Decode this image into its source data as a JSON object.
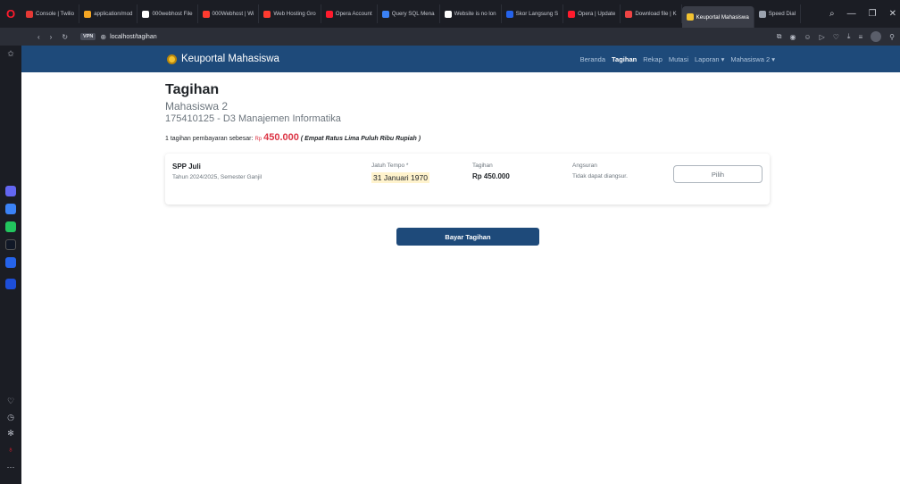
{
  "browser": {
    "logo": "O",
    "tabs": [
      {
        "label": "Console | Twilio",
        "color": "#e53935"
      },
      {
        "label": "application/mod",
        "color": "#f5a623"
      },
      {
        "label": "000webhost File",
        "color": "#ffffff"
      },
      {
        "label": "000Webhost | Wi",
        "color": "#ff3b30"
      },
      {
        "label": "Web Hosting Gro",
        "color": "#ff3b30"
      },
      {
        "label": "Opera Account",
        "color": "#ff1b2d"
      },
      {
        "label": "Query SQL Mena",
        "color": "#3b82f6"
      },
      {
        "label": "Website is no lon",
        "color": "#ffffff"
      },
      {
        "label": "Skor Langsung S",
        "color": "#2563eb"
      },
      {
        "label": "Opera | Update",
        "color": "#ff1b2d"
      },
      {
        "label": "Download file | K",
        "color": "#ef4444"
      },
      {
        "label": "Keuportal Mahasiswa",
        "color": "#f2c230",
        "active": true
      },
      {
        "label": "Speed Dial",
        "color": "#9ca3af"
      }
    ],
    "window_controls": [
      "⌕",
      "—",
      "❐",
      "✕"
    ],
    "address": {
      "vpn": "VPN",
      "url": "localhost/tagihan"
    }
  },
  "navbar": {
    "brand": "Keuportal Mahasiswa",
    "links": [
      {
        "label": "Beranda",
        "active": false
      },
      {
        "label": "Tagihan",
        "active": true
      },
      {
        "label": "Rekap",
        "active": false
      },
      {
        "label": "Mutasi",
        "active": false
      },
      {
        "label": "Laporan ▾",
        "active": false
      },
      {
        "label": "Mahasiswa 2 ▾",
        "active": false
      }
    ]
  },
  "page": {
    "title": "Tagihan",
    "student_name": "Mahasiswa 2",
    "student_id": "175410125 - D3 Manajemen Informatika",
    "summary_prefix": "1 tagihan pembayaran sebesar:",
    "summary_rp": "Rp",
    "summary_amount": "450.000",
    "summary_words": "( Empat Ratus Lima Puluh Ribu Rupiah )"
  },
  "bill": {
    "name": "SPP Juli",
    "subtitle": "Tahun 2024/2025, Semester Ganjil",
    "due_label": "Jatuh Tempo *",
    "due_value": "31 Januari 1970",
    "amount_label": "Tagihan",
    "amount_value": "Rp 450.000",
    "installment_label": "Angsuran",
    "installment_value": "Tidak dapat diangsur.",
    "select_label": "Pilih"
  },
  "pay_button": "Bayar Tagihan",
  "colors": {
    "navbar": "#1e4a7a",
    "amount": "#dc3545",
    "due_highlight": "#fff3cd"
  }
}
